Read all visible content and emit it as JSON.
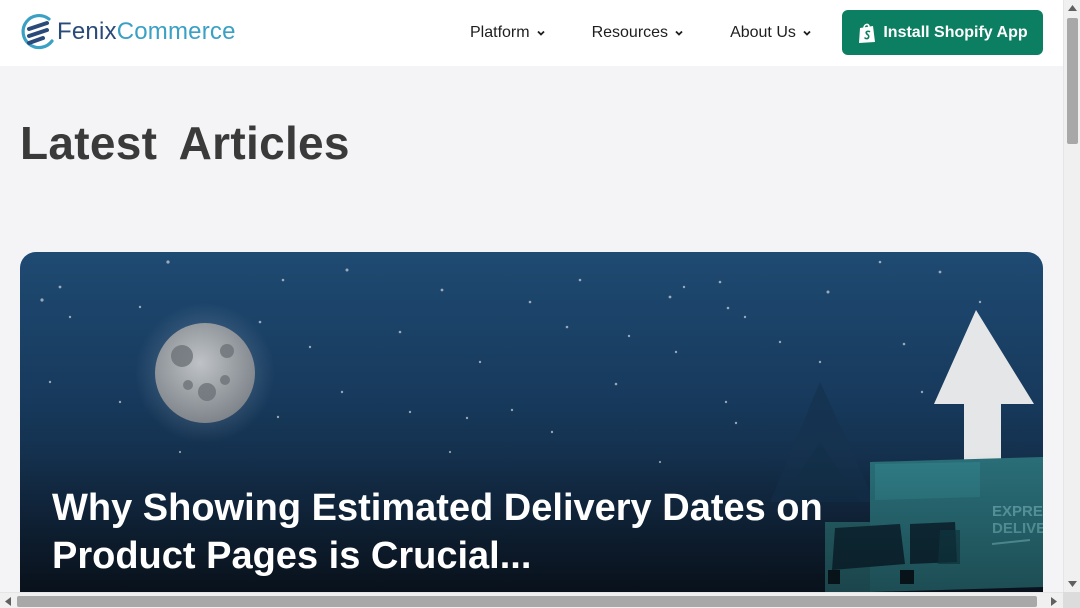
{
  "header": {
    "logo": {
      "text_part1": "Fenix",
      "text_part2": "Commerce",
      "icon": "fenix-logo-icon"
    },
    "nav": [
      {
        "label": "Platform",
        "icon": "chevron-down-icon"
      },
      {
        "label": "Resources",
        "icon": "chevron-down-icon"
      },
      {
        "label": "About Us",
        "icon": "chevron-down-icon"
      }
    ],
    "cta": {
      "label": "Install Shopify App",
      "icon": "shopify-bag-icon",
      "color": "#0c7f63"
    }
  },
  "main": {
    "title": "Latest  Articles",
    "featured_article": {
      "title": "Why Showing Estimated Delivery Dates on Product Pages is Crucial...",
      "image_text": "EXPRESS DELIVERY"
    }
  },
  "scrollbars": {
    "vertical": {
      "up_icon": "triangle-up-icon",
      "down_icon": "triangle-down-icon"
    },
    "horizontal": {
      "left_icon": "triangle-left-icon",
      "right_icon": "triangle-right-icon"
    }
  }
}
